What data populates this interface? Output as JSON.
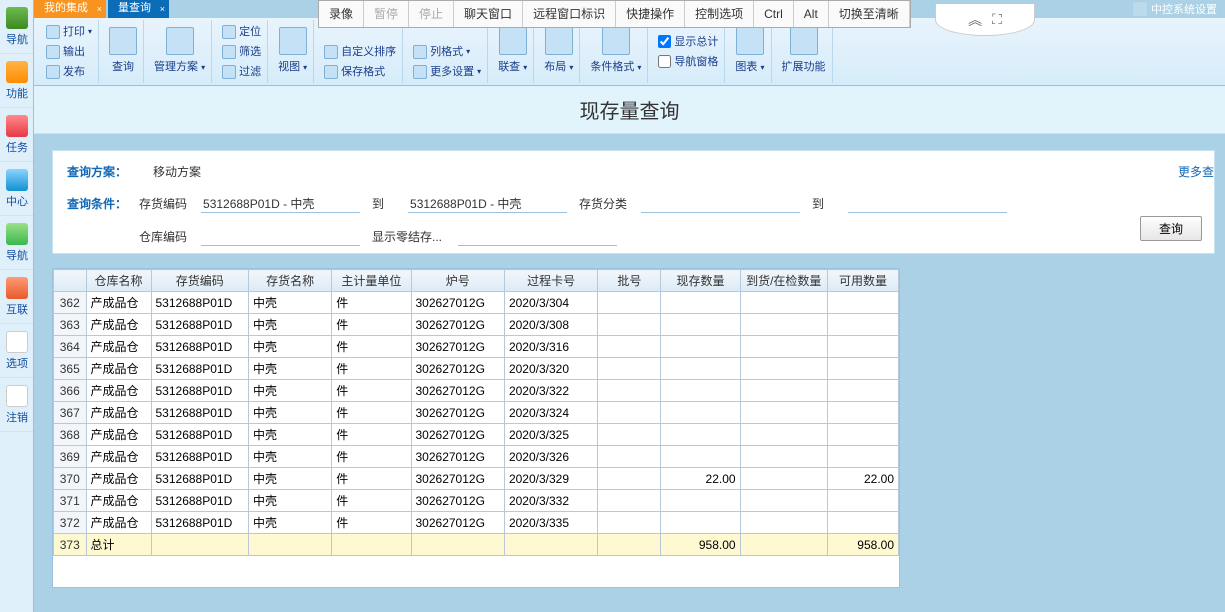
{
  "tabs": [
    {
      "label": "我的集成",
      "kind": "orange"
    },
    {
      "label": "量查询",
      "kind": "blue"
    }
  ],
  "floatbar": {
    "items": [
      "录像",
      "暂停",
      "停止",
      "聊天窗口",
      "远程窗口标识",
      "快捷操作",
      "控制选项",
      "Ctrl",
      "Alt",
      "切换至清晰"
    ],
    "disabled": [
      1,
      2
    ]
  },
  "sidebar": {
    "items": [
      "导航",
      "功能",
      "任务",
      "中心",
      "导航",
      "互联",
      "选项",
      "注销"
    ]
  },
  "ribbon": {
    "left": {
      "print": "打印",
      "output": "输出",
      "publish": "发布"
    },
    "query": "查询",
    "manage": "管理方案",
    "locate": "定位",
    "filter": "筛选",
    "filterBtn": "过滤",
    "view": "视图",
    "custom": "自定义排序",
    "saveFmt": "保存格式",
    "colFmt": "列格式",
    "moreSet": "更多设置",
    "link": "联查",
    "layout": "布局",
    "condFmt": "条件格式",
    "showTotal": "显示总计",
    "navPane": "导航窗格",
    "chart": "图表",
    "extend": "扩展功能"
  },
  "pageTitle": "现存量查询",
  "query": {
    "planLabel": "查询方案：",
    "planName": "移动方案",
    "condLabel": "查询条件：",
    "invCodeLabel": "存货编码",
    "invCode1": "5312688P01D - 中壳",
    "toLabel": "到",
    "invCode2": "5312688P01D - 中壳",
    "invCatLabel": "存货分类",
    "toLabel2": "到",
    "whLabel": "仓库编码",
    "zeroLabel": "显示零结存...",
    "moreLink": "更多查",
    "searchBtn": "查询"
  },
  "table": {
    "headers": [
      "",
      "仓库名称",
      "存货编码",
      "存货名称",
      "主计量单位",
      "炉号",
      "过程卡号",
      "批号",
      "现存数量",
      "到货/在检数量",
      "可用数量"
    ],
    "rows": [
      {
        "n": "362",
        "wh": "产成品仓",
        "code": "5312688P01D",
        "name": "中壳",
        "unit": "件",
        "furnace": "302627012G",
        "card": "2020/3/304",
        "batch": "",
        "qty": "",
        "inQty": "",
        "avail": ""
      },
      {
        "n": "363",
        "wh": "产成品仓",
        "code": "5312688P01D",
        "name": "中壳",
        "unit": "件",
        "furnace": "302627012G",
        "card": "2020/3/308",
        "batch": "",
        "qty": "",
        "inQty": "",
        "avail": ""
      },
      {
        "n": "364",
        "wh": "产成品仓",
        "code": "5312688P01D",
        "name": "中壳",
        "unit": "件",
        "furnace": "302627012G",
        "card": "2020/3/316",
        "batch": "",
        "qty": "",
        "inQty": "",
        "avail": ""
      },
      {
        "n": "365",
        "wh": "产成品仓",
        "code": "5312688P01D",
        "name": "中壳",
        "unit": "件",
        "furnace": "302627012G",
        "card": "2020/3/320",
        "batch": "",
        "qty": "",
        "inQty": "",
        "avail": ""
      },
      {
        "n": "366",
        "wh": "产成品仓",
        "code": "5312688P01D",
        "name": "中壳",
        "unit": "件",
        "furnace": "302627012G",
        "card": "2020/3/322",
        "batch": "",
        "qty": "",
        "inQty": "",
        "avail": ""
      },
      {
        "n": "367",
        "wh": "产成品仓",
        "code": "5312688P01D",
        "name": "中壳",
        "unit": "件",
        "furnace": "302627012G",
        "card": "2020/3/324",
        "batch": "",
        "qty": "",
        "inQty": "",
        "avail": ""
      },
      {
        "n": "368",
        "wh": "产成品仓",
        "code": "5312688P01D",
        "name": "中壳",
        "unit": "件",
        "furnace": "302627012G",
        "card": "2020/3/325",
        "batch": "",
        "qty": "",
        "inQty": "",
        "avail": ""
      },
      {
        "n": "369",
        "wh": "产成品仓",
        "code": "5312688P01D",
        "name": "中壳",
        "unit": "件",
        "furnace": "302627012G",
        "card": "2020/3/326",
        "batch": "",
        "qty": "",
        "inQty": "",
        "avail": ""
      },
      {
        "n": "370",
        "wh": "产成品仓",
        "code": "5312688P01D",
        "name": "中壳",
        "unit": "件",
        "furnace": "302627012G",
        "card": "2020/3/329",
        "batch": "",
        "qty": "22.00",
        "inQty": "",
        "avail": "22.00"
      },
      {
        "n": "371",
        "wh": "产成品仓",
        "code": "5312688P01D",
        "name": "中壳",
        "unit": "件",
        "furnace": "302627012G",
        "card": "2020/3/332",
        "batch": "",
        "qty": "",
        "inQty": "",
        "avail": ""
      },
      {
        "n": "372",
        "wh": "产成品仓",
        "code": "5312688P01D",
        "name": "中壳",
        "unit": "件",
        "furnace": "302627012G",
        "card": "2020/3/335",
        "batch": "",
        "qty": "",
        "inQty": "",
        "avail": ""
      }
    ],
    "summary": {
      "n": "373",
      "label": "总计",
      "qty": "958.00",
      "avail": "958.00"
    }
  },
  "topright": "中控系统设置"
}
